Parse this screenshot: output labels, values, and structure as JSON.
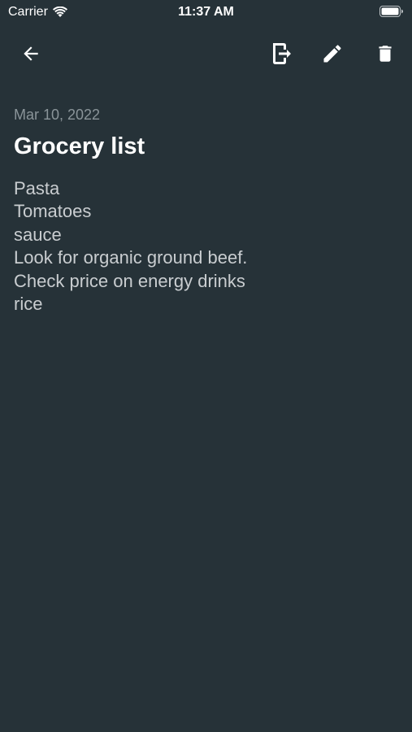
{
  "status_bar": {
    "carrier": "Carrier",
    "time": "11:37 AM",
    "wifi_icon": "wifi-icon",
    "battery_icon": "battery-icon"
  },
  "toolbar": {
    "back_icon": "arrow-back-icon",
    "export_icon": "export-icon",
    "edit_icon": "pencil-icon",
    "delete_icon": "trash-icon"
  },
  "note": {
    "date": "Mar 10, 2022",
    "title": "Grocery list",
    "lines": [
      "Pasta",
      "Tomatoes",
      "sauce",
      "Look for organic ground beef.",
      "Check price on energy drinks",
      "rice"
    ]
  },
  "colors": {
    "background": "#263238",
    "date_text": "#8a9499",
    "body_text": "#c9cdd0",
    "title_text": "#ffffff"
  }
}
